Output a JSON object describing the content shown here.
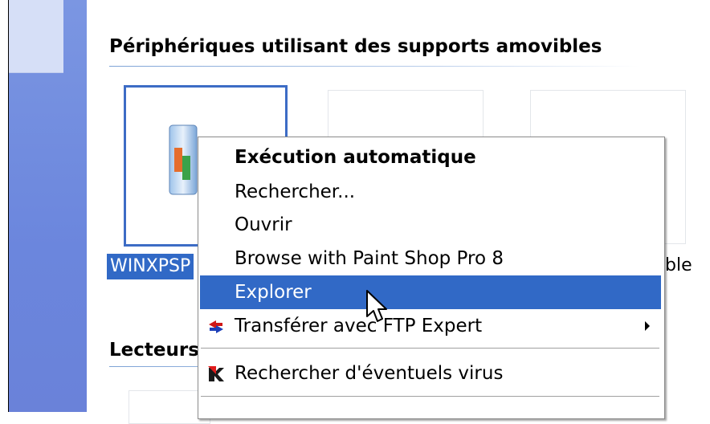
{
  "sections": {
    "removable_title": "Périphériques utilisant des supports amovibles",
    "drives_title": "Lecteurs"
  },
  "devices": {
    "selected_label": "WINXPSP",
    "right_label_fragment": "ble"
  },
  "context_menu": {
    "items": [
      {
        "label": "Exécution automatique"
      },
      {
        "label": "Rechercher..."
      },
      {
        "label": "Ouvrir"
      },
      {
        "label": "Browse with Paint Shop Pro 8"
      },
      {
        "label": "Explorer"
      },
      {
        "label": "Transférer avec FTP Expert"
      },
      {
        "label": "Rechercher d'éventuels virus"
      }
    ]
  },
  "icons": {
    "drive": "removable-drive-icon",
    "ftp": "ftp-expert-icon",
    "antivirus": "antivirus-icon",
    "submenu": "submenu-arrow-icon",
    "cursor": "mouse-pointer-icon"
  },
  "colors": {
    "sidebar": "#6b86dd",
    "selection": "#3169c6",
    "tile_selected_border": "#3d6cc5"
  }
}
